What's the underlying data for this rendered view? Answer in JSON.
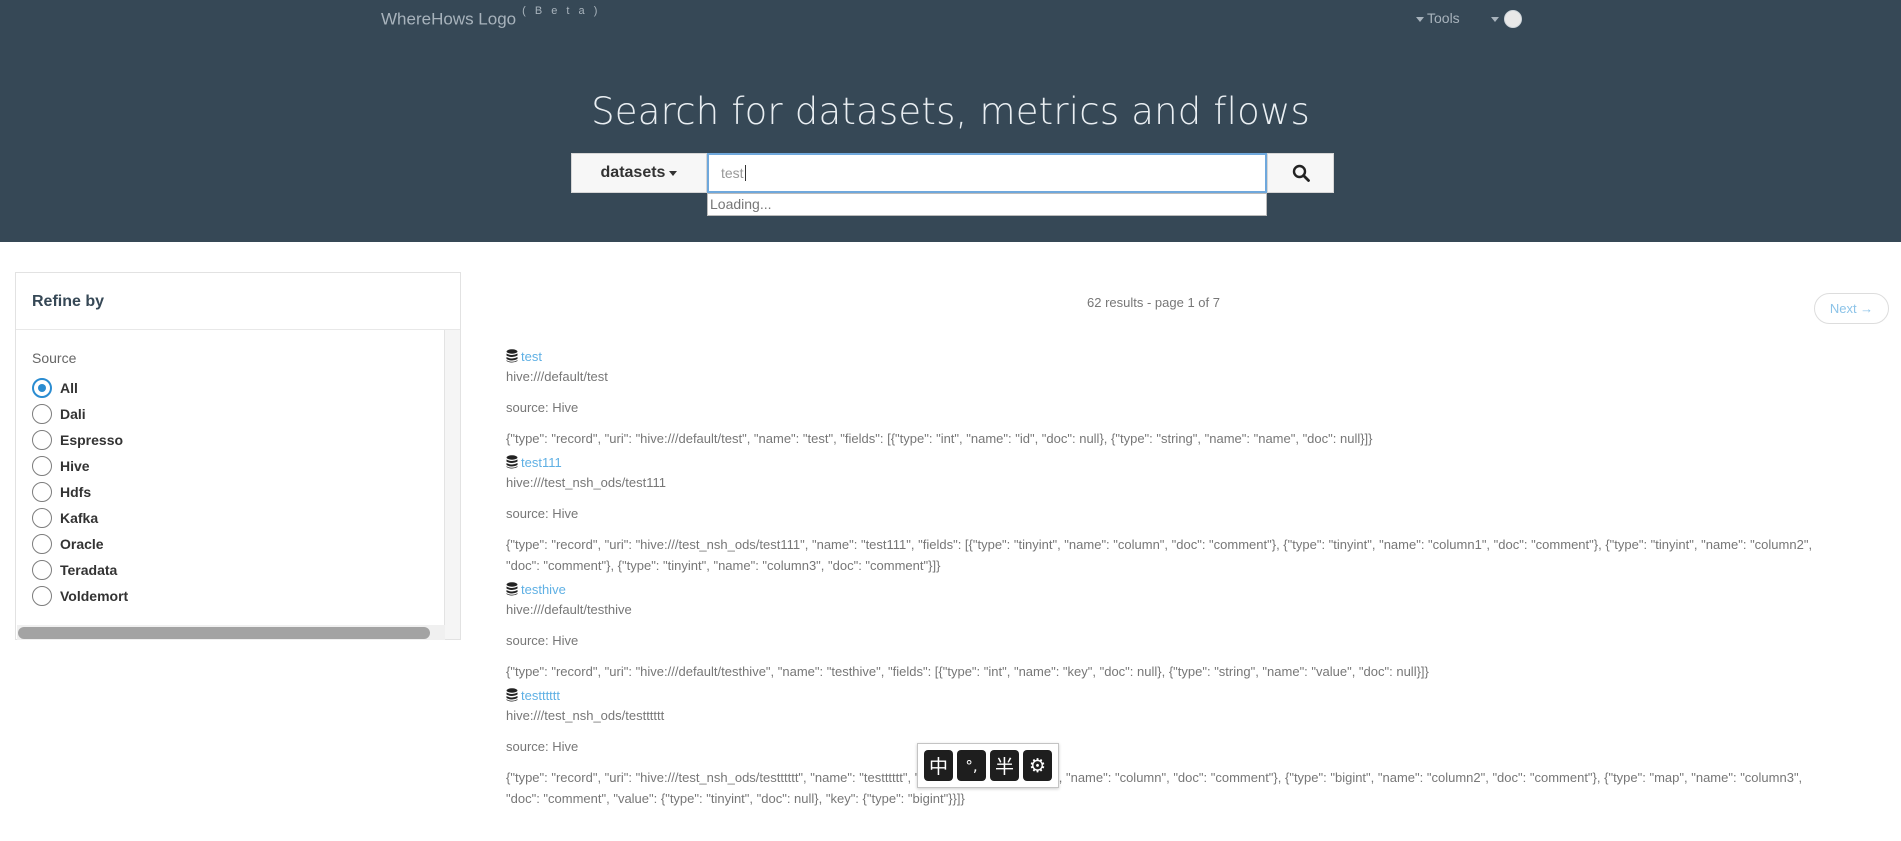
{
  "header": {
    "logo_text": "WhereHows Logo",
    "beta_label": "( B e t a )",
    "tools_label": "Tools"
  },
  "hero": {
    "title": "Search for datasets, metrics and flows"
  },
  "search": {
    "category": "datasets",
    "value": "test",
    "suggestion_status": "Loading..."
  },
  "sidebar": {
    "title": "Refine by",
    "source_label": "Source",
    "options": [
      {
        "label": "All",
        "checked": true
      },
      {
        "label": "Dali",
        "checked": false
      },
      {
        "label": "Espresso",
        "checked": false
      },
      {
        "label": "Hive",
        "checked": false
      },
      {
        "label": "Hdfs",
        "checked": false
      },
      {
        "label": "Kafka",
        "checked": false
      },
      {
        "label": "Oracle",
        "checked": false
      },
      {
        "label": "Teradata",
        "checked": false
      },
      {
        "label": "Voldemort",
        "checked": false
      }
    ]
  },
  "results": {
    "summary": "62 results - page 1 of 7",
    "next_label": "Next →",
    "items": [
      {
        "name": "test",
        "uri": "hive:///default/test",
        "source": "source: Hive",
        "schema_lines": [
          "{\"type\": \"record\", \"uri\": \"hive:///default/test\", \"name\": \"test\", \"fields\": [{\"type\": \"int\", \"name\": \"id\", \"doc\": null}, {\"type\": \"string\", \"name\": \"name\", \"doc\": null}]}"
        ]
      },
      {
        "name": "test111",
        "uri": "hive:///test_nsh_ods/test111",
        "source": "source: Hive",
        "schema_lines": [
          "{\"type\": \"record\", \"uri\": \"hive:///test_nsh_ods/test111\", \"name\": \"test111\", \"fields\": [{\"type\": \"tinyint\", \"name\": \"column\", \"doc\": \"comment\"}, {\"type\": \"tinyint\", \"name\": \"column1\", \"doc\": \"comment\"}, {\"type\": \"tinyint\", \"name\": \"column2\",",
          "\"doc\": \"comment\"}, {\"type\": \"tinyint\", \"name\": \"column3\", \"doc\": \"comment\"}]}"
        ]
      },
      {
        "name": "testhive",
        "uri": "hive:///default/testhive",
        "source": "source: Hive",
        "schema_lines": [
          "{\"type\": \"record\", \"uri\": \"hive:///default/testhive\", \"name\": \"testhive\", \"fields\": [{\"type\": \"int\", \"name\": \"key\", \"doc\": null}, {\"type\": \"string\", \"name\": \"value\", \"doc\": null}]}"
        ]
      },
      {
        "name": "testttttt",
        "uri": "hive:///test_nsh_ods/testttttt",
        "source": "source: Hive",
        "schema_lines": [
          "{\"type\": \"record\", \"uri\": \"hive:///test_nsh_ods/testttttt\", \"name\": \"testttttt\", \"fields\": [{\"type\": \"double\", \"name\": \"column\", \"doc\": \"comment\"}, {\"type\": \"bigint\", \"name\": \"column2\", \"doc\": \"comment\"}, {\"type\": \"map\", \"name\": \"column3\",",
          "\"doc\": \"comment\", \"value\": {\"type\": \"tinyint\", \"doc\": null}, \"key\": {\"type\": \"bigint\"}}]}"
        ]
      }
    ]
  },
  "ime": {
    "buttons": [
      {
        "label": "中",
        "icon": "chinese-mode-icon"
      },
      {
        "label": "°,",
        "icon": "punctuation-icon"
      },
      {
        "label": "半",
        "icon": "half-width-icon"
      },
      {
        "label": "⚙",
        "icon": "gear-icon"
      }
    ]
  }
}
